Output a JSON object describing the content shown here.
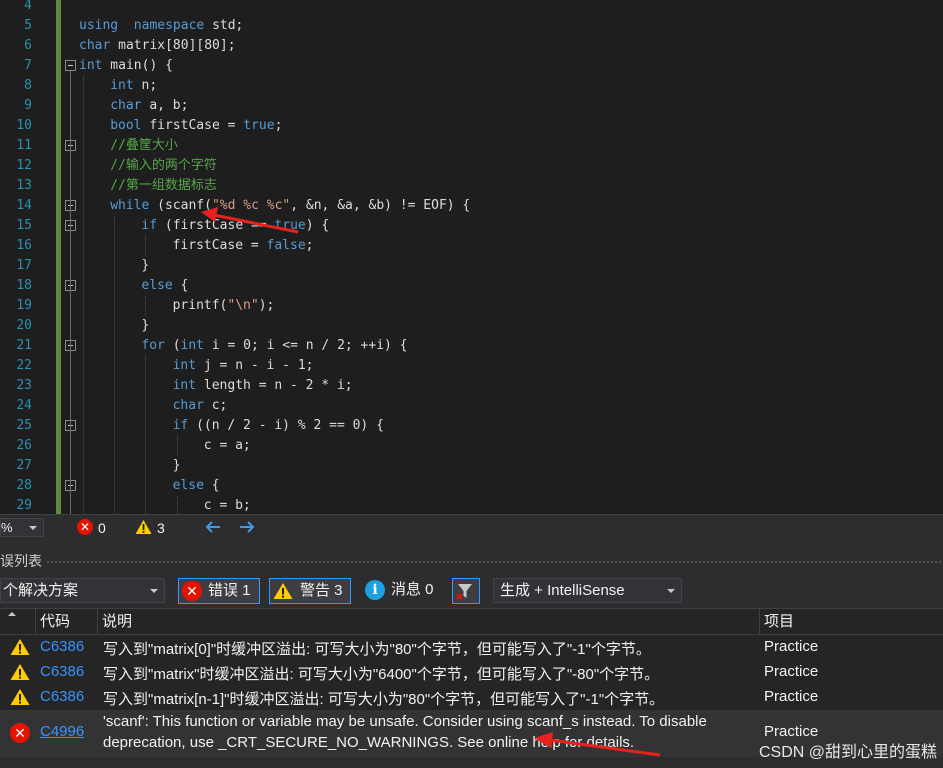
{
  "editor": {
    "lines": [
      {
        "n": "4",
        "t": []
      },
      {
        "n": "5",
        "t": [
          [
            "kw",
            "using"
          ],
          [
            "",
            "  "
          ],
          [
            "kw",
            "namespace"
          ],
          [
            "",
            " std;"
          ]
        ]
      },
      {
        "n": "6",
        "t": [
          [
            "kw",
            "char"
          ],
          [
            "",
            " matrix[80][80];"
          ]
        ]
      },
      {
        "n": "7",
        "t": [
          [
            "kw",
            "int"
          ],
          [
            "",
            " main() {"
          ]
        ]
      },
      {
        "n": "8",
        "t": [
          [
            "kw",
            "int"
          ],
          [
            "",
            " n;"
          ]
        ]
      },
      {
        "n": "9",
        "t": [
          [
            "kw",
            "char"
          ],
          [
            "",
            " a, b;"
          ]
        ]
      },
      {
        "n": "10",
        "t": [
          [
            "kw",
            "bool"
          ],
          [
            "",
            " firstCase = "
          ],
          [
            "kw",
            "true"
          ],
          [
            "",
            ";"
          ]
        ]
      },
      {
        "n": "11",
        "t": [
          [
            "cmt",
            "//叠筐大小"
          ]
        ]
      },
      {
        "n": "12",
        "t": [
          [
            "cmt",
            "//输入的两个字符"
          ]
        ]
      },
      {
        "n": "13",
        "t": [
          [
            "cmt",
            "//第一组数据标志"
          ]
        ]
      },
      {
        "n": "14",
        "t": [
          [
            "kw",
            "while"
          ],
          [
            "",
            " (scanf("
          ],
          [
            "str",
            "\"%d %c %c\""
          ],
          [
            "",
            ", &n, &a, &b) != EOF) {"
          ]
        ]
      },
      {
        "n": "15",
        "t": [
          [
            "kw",
            "if"
          ],
          [
            "",
            " (firstCase == "
          ],
          [
            "kw",
            "true"
          ],
          [
            "",
            ") {"
          ]
        ]
      },
      {
        "n": "16",
        "t": [
          [
            "",
            "firstCase = "
          ],
          [
            "kw",
            "false"
          ],
          [
            "",
            ";"
          ]
        ]
      },
      {
        "n": "17",
        "t": [
          [
            "",
            "}"
          ]
        ]
      },
      {
        "n": "18",
        "t": [
          [
            "kw",
            "else"
          ],
          [
            "",
            " {"
          ]
        ]
      },
      {
        "n": "19",
        "t": [
          [
            "",
            "printf("
          ],
          [
            "str",
            "\"\\n\""
          ],
          [
            "",
            ");"
          ]
        ]
      },
      {
        "n": "20",
        "t": [
          [
            "",
            "}"
          ]
        ]
      },
      {
        "n": "21",
        "t": [
          [
            "kw",
            "for"
          ],
          [
            "",
            " ("
          ],
          [
            "kw",
            "int"
          ],
          [
            "",
            " i = 0; i <= n / 2; ++i) {"
          ]
        ]
      },
      {
        "n": "22",
        "t": [
          [
            "kw",
            "int"
          ],
          [
            "",
            " j = n - i - 1;"
          ]
        ]
      },
      {
        "n": "23",
        "t": [
          [
            "kw",
            "int"
          ],
          [
            "",
            " length = n - 2 * i;"
          ]
        ]
      },
      {
        "n": "24",
        "t": [
          [
            "kw",
            "char"
          ],
          [
            "",
            " c;"
          ]
        ]
      },
      {
        "n": "25",
        "t": [
          [
            "kw",
            "if"
          ],
          [
            "",
            " ((n / 2 - i) % 2 == 0) {"
          ]
        ]
      },
      {
        "n": "26",
        "t": [
          [
            "",
            "c = a;"
          ]
        ]
      },
      {
        "n": "27",
        "t": [
          [
            "",
            "}"
          ]
        ]
      },
      {
        "n": "28",
        "t": [
          [
            "kw",
            "else"
          ],
          [
            "",
            " {"
          ]
        ]
      },
      {
        "n": "29",
        "t": [
          [
            "",
            "c = b;"
          ]
        ]
      }
    ]
  },
  "status": {
    "zoom": "%",
    "errors": "0",
    "warnings": "3"
  },
  "panel": {
    "title": "误列表",
    "scope": "个解决方案",
    "errors_btn": "错误 1",
    "warnings_btn": "警告 3",
    "messages_btn": "消息 0",
    "build_filter": "生成 + IntelliSense",
    "headers": {
      "code": "代码",
      "desc": "说明",
      "project": "项目"
    }
  },
  "rows": [
    {
      "severity": "warning",
      "code": "C6386",
      "desc": "写入到\"matrix[0]\"时缓冲区溢出: 可写大小为\"80\"个字节，但可能写入了\"-1\"个字节。",
      "project": "Practice"
    },
    {
      "severity": "warning",
      "code": "C6386",
      "desc": "写入到\"matrix\"时缓冲区溢出: 可写大小为\"6400\"个字节，但可能写入了\"-80\"个字节。",
      "project": "Practice"
    },
    {
      "severity": "warning",
      "code": "C6386",
      "desc": "写入到\"matrix[n-1]\"时缓冲区溢出: 可写大小为\"80\"个字节，但可能写入了\"-1\"个字节。",
      "project": "Practice"
    },
    {
      "severity": "error",
      "code": "C4996",
      "desc1": "'scanf': This function or variable may be unsafe. Consider using scanf_s instead. To disable",
      "desc2": "deprecation, use _CRT_SECURE_NO_WARNINGS. See online help for details.",
      "project": "Practice"
    }
  ],
  "watermark": "CSDN @甜到心里的蛋糕",
  "colors": {
    "accent": "#3399ff",
    "error": "#e51400",
    "warning": "#ffcc00",
    "link": "#3794ff",
    "annotation": "#e8211c"
  }
}
